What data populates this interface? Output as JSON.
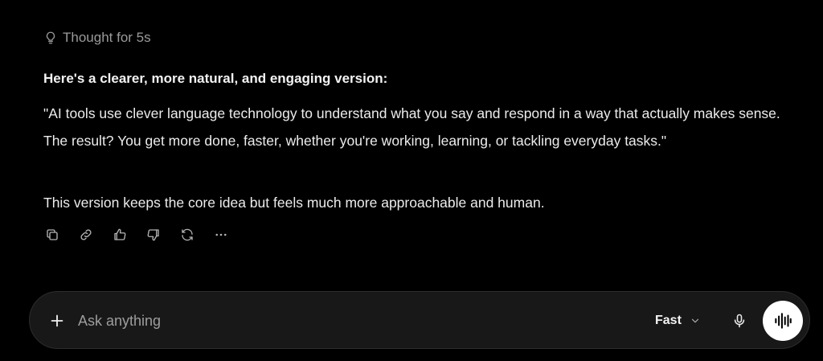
{
  "thought": {
    "label": "Thought for 5s",
    "icon": "lightbulb-icon"
  },
  "message": {
    "heading": "Here's a clearer, more natural, and engaging version:",
    "quote": "\"AI tools use clever language technology to understand what you say and respond in a way that actually makes sense. The result? You get more done, faster, whether you're working, learning, or tackling everyday tasks.\"",
    "summary": "This version keeps the core idea but feels much more approachable and human."
  },
  "actions": [
    {
      "name": "copy",
      "icon": "copy-icon"
    },
    {
      "name": "share-link",
      "icon": "link-icon"
    },
    {
      "name": "good-response",
      "icon": "thumbs-up-icon"
    },
    {
      "name": "bad-response",
      "icon": "thumbs-down-icon"
    },
    {
      "name": "regenerate",
      "icon": "refresh-icon"
    },
    {
      "name": "more",
      "icon": "more-icon"
    }
  ],
  "composer": {
    "placeholder": "Ask anything",
    "value": "",
    "model_label": "Fast",
    "add_icon": "plus-icon",
    "mic_icon": "microphone-icon",
    "voice_icon": "voice-waveform-icon"
  },
  "colors": {
    "background": "#000000",
    "text": "#ececec",
    "muted": "#9a9a9a",
    "composer_bg": "#181818",
    "voice_button": "#ffffff"
  }
}
